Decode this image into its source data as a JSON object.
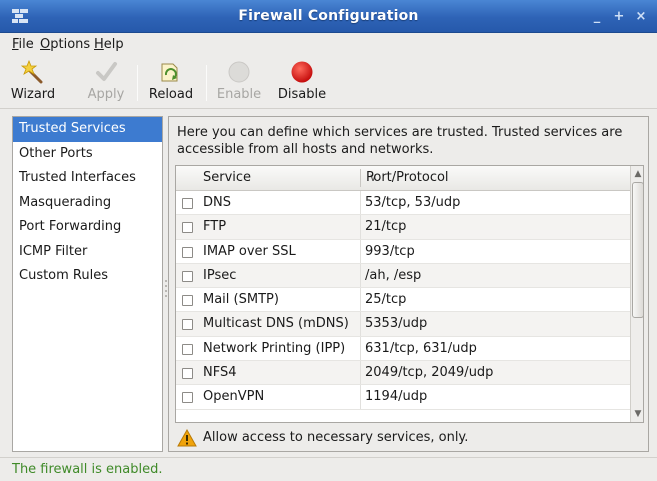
{
  "window": {
    "title": "Firewall Configuration"
  },
  "menubar": {
    "items": [
      {
        "label": "File",
        "accel": "F",
        "rest": "ile"
      },
      {
        "label": "Options",
        "accel": "O",
        "rest": "ptions"
      },
      {
        "label": "Help",
        "accel": "H",
        "rest": "elp"
      }
    ]
  },
  "toolbar": {
    "wizard": {
      "label": "Wizard",
      "icon": "wizard-wand-icon"
    },
    "apply": {
      "label": "Apply",
      "icon": "apply-check-icon",
      "enabled": false
    },
    "reload": {
      "label": "Reload",
      "icon": "reload-icon"
    },
    "enable": {
      "label": "Enable",
      "icon": "enable-circle-icon",
      "enabled": false
    },
    "disable": {
      "label": "Disable",
      "icon": "disable-red-circle-icon",
      "color": "#e01b1b"
    }
  },
  "sidebar": {
    "items": [
      {
        "label": "Trusted Services",
        "selected": true
      },
      {
        "label": "Other Ports"
      },
      {
        "label": "Trusted Interfaces"
      },
      {
        "label": "Masquerading"
      },
      {
        "label": "Port Forwarding"
      },
      {
        "label": "ICMP Filter"
      },
      {
        "label": "Custom Rules"
      }
    ]
  },
  "main": {
    "description": "Here you can define which services are trusted. Trusted services are accessible from all hosts and networks.",
    "table": {
      "columns": {
        "service": "Service",
        "port": "Port/Protocol"
      },
      "rows": [
        {
          "service": "DNS",
          "port": "53/tcp, 53/udp",
          "checked": false
        },
        {
          "service": "FTP",
          "port": "21/tcp",
          "checked": false
        },
        {
          "service": "IMAP over SSL",
          "port": "993/tcp",
          "checked": false
        },
        {
          "service": "IPsec",
          "port": "/ah, /esp",
          "checked": false
        },
        {
          "service": "Mail (SMTP)",
          "port": "25/tcp",
          "checked": false
        },
        {
          "service": "Multicast DNS (mDNS)",
          "port": "5353/udp",
          "checked": false
        },
        {
          "service": "Network Printing (IPP)",
          "port": "631/tcp, 631/udp",
          "checked": false
        },
        {
          "service": "NFS4",
          "port": "2049/tcp, 2049/udp",
          "checked": false
        },
        {
          "service": "OpenVPN",
          "port": "1194/udp",
          "checked": false
        }
      ]
    },
    "warning": "Allow access to necessary services, only."
  },
  "statusbar": {
    "text": "The firewall is enabled."
  },
  "colors": {
    "accent": "#3d7bd0",
    "status_ok": "#3f8a28",
    "warning": "#f0a30a"
  }
}
